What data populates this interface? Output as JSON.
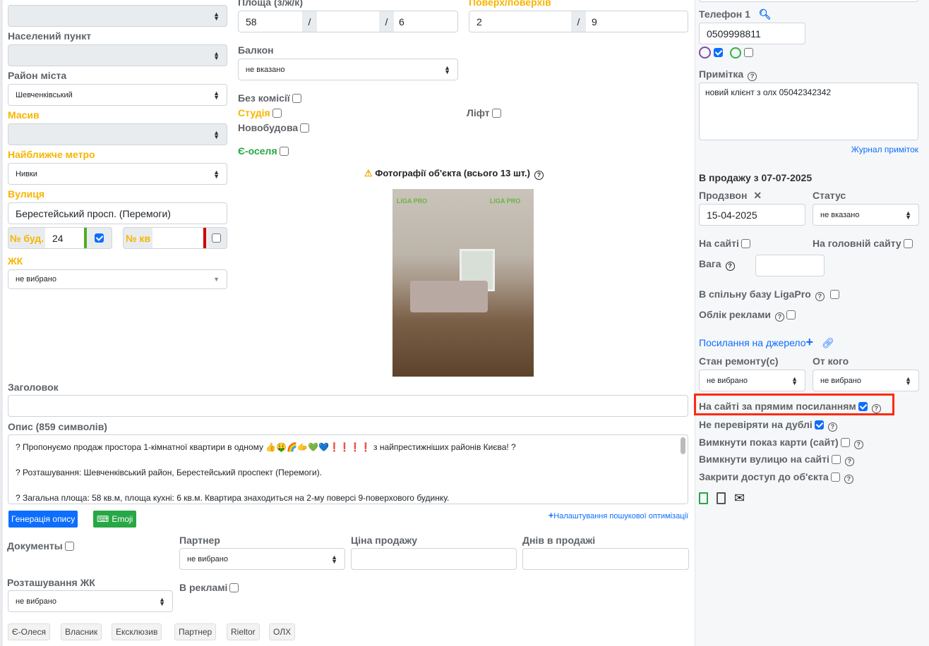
{
  "left": {
    "locality_label": "Населений пункт",
    "district_label": "Район міста",
    "district_value": "Шевченківський",
    "massif_label": "Масив",
    "metro_label": "Найближче метро",
    "metro_value": "Нивки",
    "street_label": "Вулиця",
    "street_value": "Берестейський просп. (Перемоги)",
    "building_label": "№ буд.",
    "building_value": "24",
    "building_checked": true,
    "apt_label": "№ кв",
    "apt_value": "",
    "apt_checked": false,
    "complex_label": "ЖК",
    "complex_value": "не вибрано"
  },
  "middle": {
    "area_label": "Площа (з/ж/к)",
    "area_total": "58",
    "area_living": "",
    "area_kitchen": "6",
    "sep": "/",
    "floor_label": "Поверх/поверхів",
    "floor": "2",
    "floors": "9",
    "balcony_label": "Балкон",
    "balcony_value": "не вказано",
    "no_commission": "Без комісії",
    "studio": "Студія",
    "lift": "Ліфт",
    "new_building": "Новобудова",
    "eoselia": "Є-оселя",
    "photos_title": "Фотографії об'єкта (всього 13 шт.)",
    "watermark": "LIGA PRO"
  },
  "title_label": "Заголовок",
  "title_value": "",
  "desc_label": "Опис (859 символів)",
  "desc_lines": [
    "? Пропонуємо продаж простора 1-кімнатної квартири в одному 👍🤑🌈🫱💚💙❗❗❗❗ з найпрестижніших районів Києва! ?",
    "? Розташування: Шевченківський район, Берестейський проспект (Перемоги).",
    "? Загальна площа: 58 кв.м, площа кухні: 6 кв.м. Квартира знаходиться на 2-му поверсі 9-поверхового будинку."
  ],
  "gen_button": "Генерація опису",
  "emoji_button": "Emoji",
  "seo_link": "Налаштування пошукової оптимізації",
  "documents_label": "Документы",
  "partner_label": "Партнер",
  "partner_value": "не вибрано",
  "price_label": "Ціна продажу",
  "days_label": "Днів в продажі",
  "complex_loc_label": "Розташування ЖК",
  "complex_loc_value": "не вибрано",
  "ads_label": "В рекламі",
  "tags": [
    "Є-Олеся",
    "Власник",
    "Ексклюзив",
    "Партнер",
    "Rieltor",
    "ОЛХ"
  ],
  "right": {
    "phone_label": "Телефон 1",
    "phone_value": "0509998811",
    "viber_checked": true,
    "whatsapp_checked": false,
    "note_label": "Примітка",
    "note_value": "новий клієнт з олх 05042342342",
    "note_log": "Журнал приміток",
    "on_sale": "В продажу з 07-07-2025",
    "call_label": "Продзвон",
    "call_value": "15-04-2025",
    "status_label": "Статус",
    "status_value": "не вказано",
    "on_site": "На сайті",
    "on_main_site": "На головній сайту",
    "weight_label": "Вага",
    "common_base": "В спільну базу LigaPro",
    "ads_accounting": "Облік реклами",
    "source_link": "Посилання на джерело",
    "repair_label": "Стан ремонту(с)",
    "repair_value": "не вибрано",
    "from_label": "От кого",
    "from_value": "не вибрано",
    "direct_link": "На сайті за прямим посиланням",
    "no_dup": "Не перевіряти на дублі",
    "no_map": "Вимкнути показ карти (сайт)",
    "no_street": "Вимкнути вулицю на сайті",
    "close_access": "Закрити доступ до об'єкта"
  },
  "colors": {
    "accent": "#0d6efd",
    "orange": "#f7b500",
    "green": "#28a745",
    "highlight": "#ff2a12"
  }
}
